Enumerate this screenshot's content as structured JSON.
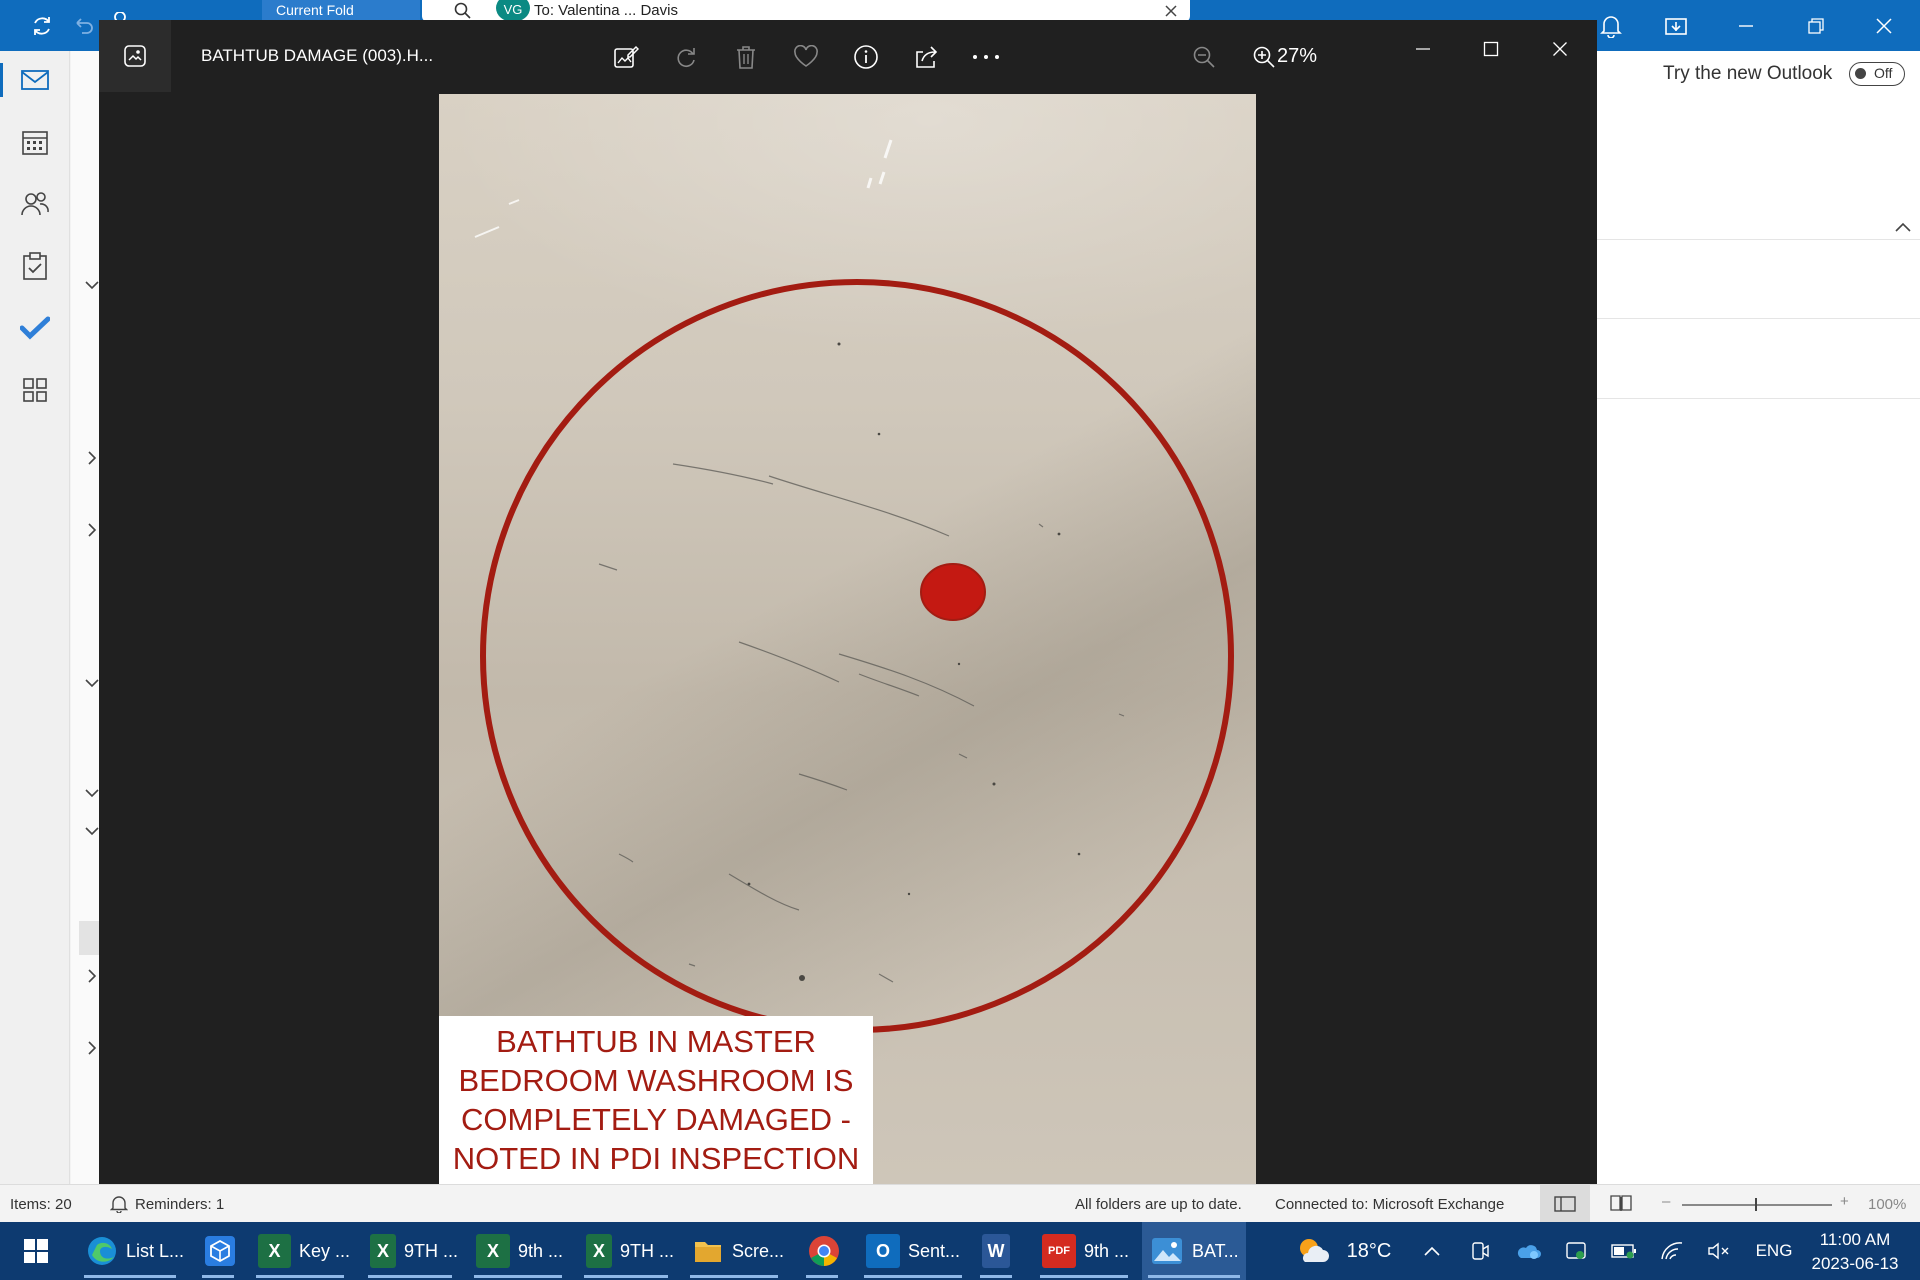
{
  "outlook": {
    "tab_strip_text": "Current Fold",
    "search_chip_avatar": "VG",
    "search_chip_text": "To: Valentina ... Davis",
    "try_new_label": "Try the new Outlook",
    "toggle_label": "Off",
    "status": {
      "items": "Items: 20",
      "reminders": "Reminders: 1",
      "sync": "All folders are up to date.",
      "connection": "Connected to: Microsoft Exchange",
      "zoom": "100%"
    }
  },
  "photos": {
    "title": "BATHTUB DAMAGE (003).H...",
    "zoom_level": "27%",
    "caption_lines": [
      "BATHTUB IN MASTER",
      "BEDROOM WASHROOM IS",
      "COMPLETELY DAMAGED -",
      "NOTED IN PDI INSPECTION"
    ],
    "annotation_color": "#a31c12"
  },
  "taskbar": {
    "items": [
      {
        "label": "List L...",
        "icon": "edge-icon",
        "color": "#1a8fd6"
      },
      {
        "label": "",
        "icon": "app-cube-icon",
        "color": "#2a7de1"
      },
      {
        "label": "Key ...",
        "icon": "excel-icon",
        "color": "#1d7044"
      },
      {
        "label": "9TH ...",
        "icon": "excel-icon",
        "color": "#1d7044"
      },
      {
        "label": "9th ...",
        "icon": "excel-icon",
        "color": "#1d7044"
      },
      {
        "label": "9TH ...",
        "icon": "excel-icon",
        "color": "#1d7044"
      },
      {
        "label": "Scre...",
        "icon": "folder-icon",
        "color": "#e8b631"
      },
      {
        "label": "",
        "icon": "chrome-icon",
        "color": "#4285f4"
      },
      {
        "label": "Sent...",
        "icon": "outlook-icon",
        "color": "#0f6cbd"
      },
      {
        "label": "",
        "icon": "word-icon",
        "color": "#2b5797"
      },
      {
        "label": "9th ...",
        "icon": "pdf-icon",
        "color": "#d42b20"
      },
      {
        "label": "BAT...",
        "icon": "photos-icon",
        "color": "#3c8fd6"
      }
    ],
    "weather": "18°C",
    "language": "ENG",
    "time": "11:00 AM",
    "date": "2023-06-13"
  }
}
